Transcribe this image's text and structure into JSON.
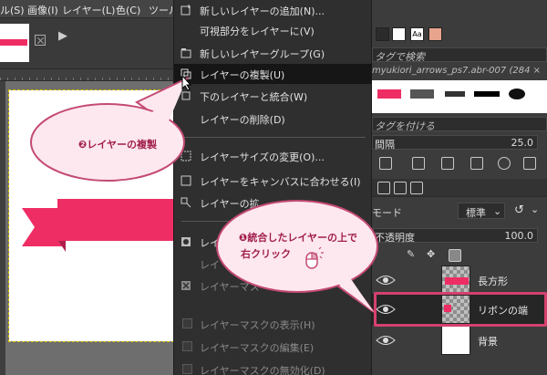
{
  "menubar": {
    "items": [
      "ル(S)",
      "画像(I)",
      "レイヤー(L)",
      "色(C)",
      "ツール"
    ]
  },
  "tab": {
    "arrow": "▶"
  },
  "context_menu": {
    "items": [
      {
        "label": "新しいレイヤーの追加(N)...",
        "icon": "new-layer-icon",
        "disabled": false
      },
      {
        "label": "可視部分をレイヤーに(V)",
        "icon": "",
        "disabled": false
      },
      {
        "label": "新しいレイヤーグループ(G)",
        "icon": "new-layer-group-icon",
        "disabled": false
      },
      {
        "label": "レイヤーの複製(U)",
        "icon": "duplicate-layer-icon",
        "disabled": false,
        "highlighted": true
      },
      {
        "label": "下のレイヤーと統合(W)",
        "icon": "merge-down-icon",
        "disabled": false
      },
      {
        "label": "レイヤーの削除(D)",
        "icon": "delete-layer-icon",
        "disabled": false
      },
      {
        "label": "レイヤーサイズの変更(O)...",
        "icon": "layer-boundary-icon",
        "disabled": false
      },
      {
        "label": "レイヤーをキャンバスに合わせる(I)",
        "icon": "layer-to-image-icon",
        "disabled": false
      },
      {
        "label": "レイヤーの拡",
        "icon": "scale-layer-icon",
        "disabled": false
      },
      {
        "label": "レイ",
        "icon": "layer-mask-icon",
        "disabled": false
      },
      {
        "label": "レイ",
        "icon": "",
        "disabled": true
      },
      {
        "label": "レイヤーマス",
        "icon": "delete-mask-icon",
        "disabled": true
      },
      {
        "label": "レイヤーマスクの表示(H)",
        "icon": "checkbox",
        "disabled": true
      },
      {
        "label": "レイヤーマスクの編集(E)",
        "icon": "checkbox",
        "disabled": true
      },
      {
        "label": "レイヤーマスクの無効化(D)",
        "icon": "checkbox",
        "disabled": true
      }
    ]
  },
  "right_panel": {
    "aa_label": "Aa",
    "tag_search_placeholder": "タグで検索",
    "brush_name": "myukiori_arrows_ps7.abr-007 (284 ×",
    "tag_add_placeholder": "タグを付ける",
    "spacing_label": "間隔",
    "spacing_value": "25.0",
    "mode_label": "モード",
    "mode_value": "標準",
    "opacity_label": "不透明度",
    "opacity_value": "100.0",
    "layers": [
      {
        "name": "長方形",
        "visible": true
      },
      {
        "name": "リボンの端",
        "visible": true,
        "active": true
      },
      {
        "name": "背景",
        "visible": true
      }
    ]
  },
  "callouts": {
    "duplicate": "❷レイヤーの複製",
    "rightclick_line1": "❶統合したレイヤーの上で",
    "rightclick_line2": "右クリック"
  },
  "colors": {
    "ribbon": "#ee2d64",
    "callout_border": "#c44a74",
    "callout_fill": "#fde8ef",
    "highlight": "#d4416f"
  }
}
